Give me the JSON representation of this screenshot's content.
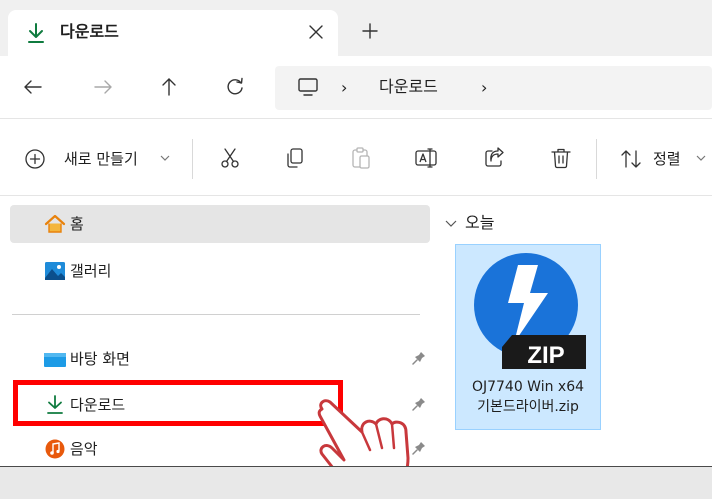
{
  "tab": {
    "title": "다운로드",
    "new_tab": "+"
  },
  "address": {
    "separator": "›",
    "breadcrumb": "다운로드",
    "trailing_separator": "›"
  },
  "toolbar": {
    "new_label": "새로 만들기",
    "sort_label": "정렬"
  },
  "sidebar": {
    "items": [
      {
        "label": "홈",
        "icon": "home-icon",
        "selected": true
      },
      {
        "label": "갤러리",
        "icon": "gallery-icon"
      },
      {
        "label": "바탕 화면",
        "icon": "desktop-icon",
        "pinned": true
      },
      {
        "label": "다운로드",
        "icon": "download-icon",
        "pinned": true,
        "highlighted": true
      },
      {
        "label": "음악",
        "icon": "music-icon",
        "pinned": true
      }
    ]
  },
  "content": {
    "group_header": "오늘",
    "files": [
      {
        "name_line1": "OJ7740 Win x64",
        "name_line2": "기본드라이버.zip",
        "icon": "zip-archive-icon",
        "icon_text": "ZIP",
        "selected": true
      }
    ]
  },
  "colors": {
    "accent": "#0078d4",
    "download_green": "#0f7b3f",
    "highlight_red": "#ff0000",
    "selection_blue": "#cce8ff",
    "zip_blue": "#1a73d9"
  }
}
